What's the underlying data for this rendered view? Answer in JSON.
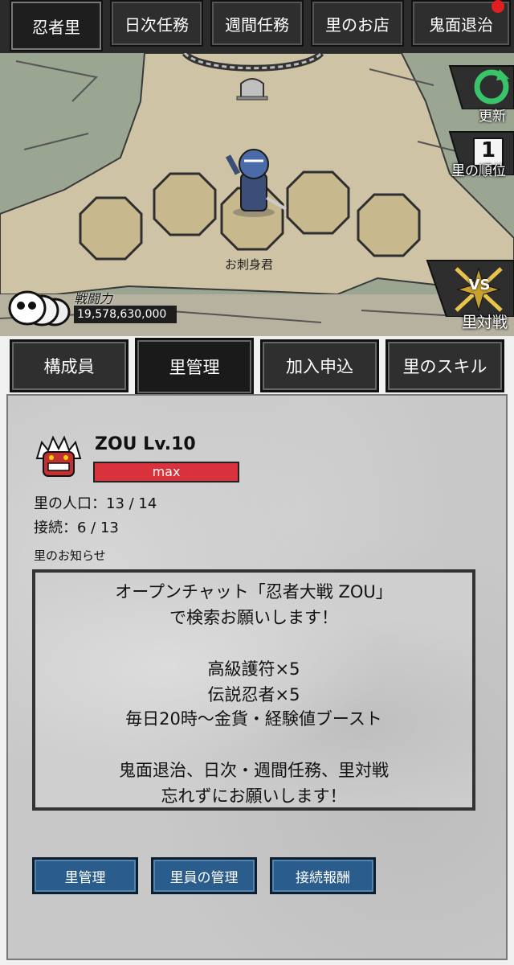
{
  "top_tabs": [
    "忍者里",
    "日次任務",
    "週間任務",
    "里のお店",
    "鬼面退治"
  ],
  "side": {
    "refresh_label": "更新",
    "rank_label": "里の順位",
    "rank_value": "1",
    "battle_label": "里対戦",
    "vs_label": "VS"
  },
  "map": {
    "character_name": "お刺身君",
    "power_label": "戦闘力",
    "power_value": "19,578,630,000"
  },
  "bottom_tabs": [
    "構成員",
    "里管理",
    "加入申込",
    "里のスキル"
  ],
  "village": {
    "name_level": "ZOU Lv.10",
    "exp_bar_label": "max",
    "population": "里の人口：13 / 14",
    "connected": "接続：6 / 13",
    "notice_title": "里のお知らせ"
  },
  "notice_lines": [
    "オープンチャット「忍者大戦 ZOU」",
    "で検索お願いします！",
    "",
    "高級護符×5",
    "伝説忍者×5",
    "毎日20時〜金貨・経験値ブースト",
    "",
    "鬼面退治、日次・週間任務、里対戦",
    "忘れずにお願いします！"
  ],
  "actions": [
    "里管理",
    "里員の管理",
    "接続報酬"
  ],
  "colors": {
    "exp_bar": "#d8323c",
    "action_button": "#2a5d8c",
    "notification_dot": "#e02020"
  }
}
